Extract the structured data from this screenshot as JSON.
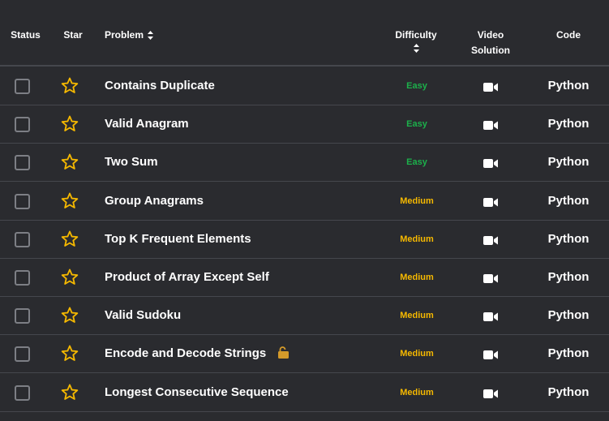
{
  "header": {
    "status": "Status",
    "star": "Star",
    "problem": "Problem",
    "difficulty": "Difficulty",
    "video_line1": "Video",
    "video_line2": "Solution",
    "code": "Code"
  },
  "colors": {
    "background": "#2a2b2f",
    "border": "#45474d",
    "star": "#f5b800",
    "easy": "#1cb04b",
    "medium": "#f5b800",
    "lock": "#d49a2a",
    "checkbox": "#7d7f85"
  },
  "icons": {
    "status": "checkbox-icon",
    "star": "star-outline-icon",
    "video": "video-camera-icon",
    "sort": "sort-icon",
    "lock": "unlock-icon"
  },
  "rows": [
    {
      "problem": "Contains Duplicate",
      "difficulty": "Easy",
      "code": "Python",
      "locked": false
    },
    {
      "problem": "Valid Anagram",
      "difficulty": "Easy",
      "code": "Python",
      "locked": false
    },
    {
      "problem": "Two Sum",
      "difficulty": "Easy",
      "code": "Python",
      "locked": false
    },
    {
      "problem": "Group Anagrams",
      "difficulty": "Medium",
      "code": "Python",
      "locked": false
    },
    {
      "problem": "Top K Frequent Elements",
      "difficulty": "Medium",
      "code": "Python",
      "locked": false
    },
    {
      "problem": "Product of Array Except Self",
      "difficulty": "Medium",
      "code": "Python",
      "locked": false
    },
    {
      "problem": "Valid Sudoku",
      "difficulty": "Medium",
      "code": "Python",
      "locked": false
    },
    {
      "problem": "Encode and Decode Strings",
      "difficulty": "Medium",
      "code": "Python",
      "locked": true
    },
    {
      "problem": "Longest Consecutive Sequence",
      "difficulty": "Medium",
      "code": "Python",
      "locked": false
    }
  ]
}
